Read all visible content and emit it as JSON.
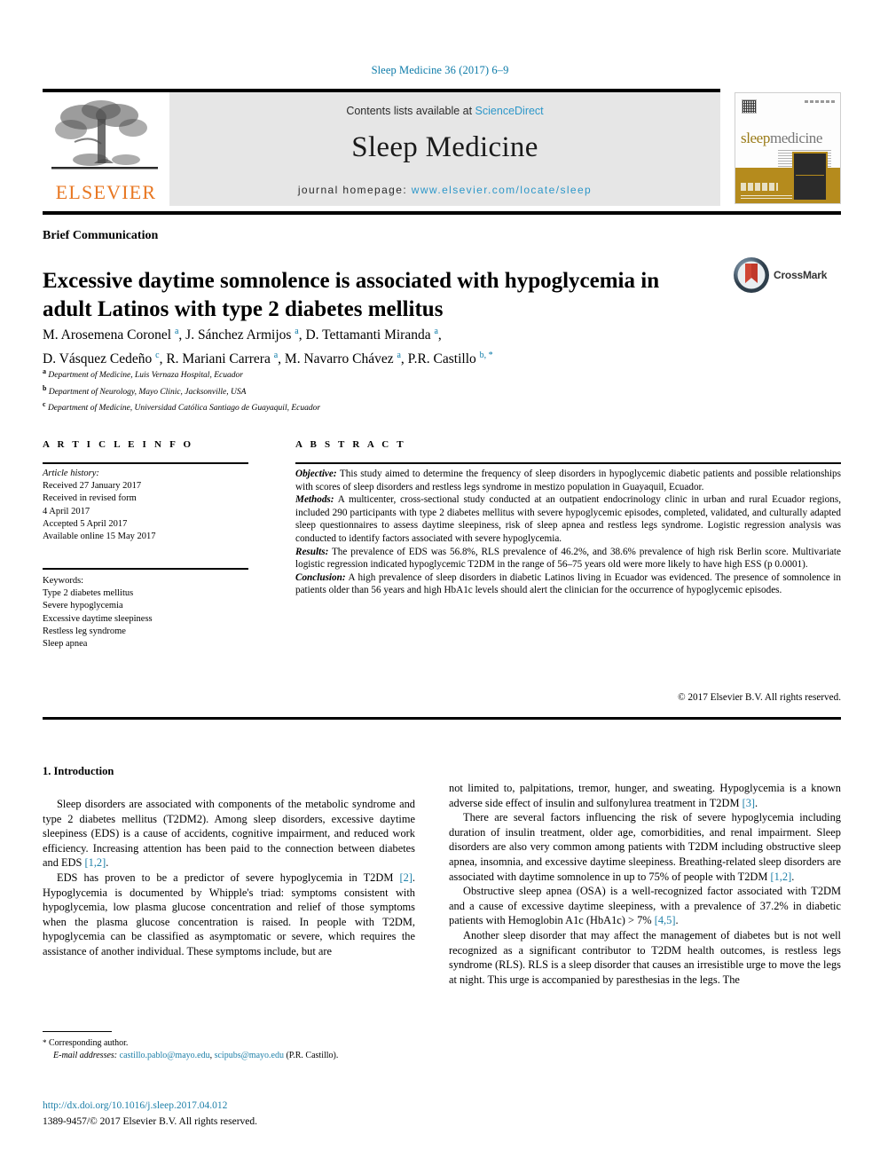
{
  "running_head": "Sleep Medicine 36 (2017) 6–9",
  "masthead": {
    "contents_prefix": "Contents lists available at ",
    "sciencedirect": "ScienceDirect",
    "journal_title": "Sleep Medicine",
    "homepage_label": "journal homepage: ",
    "homepage_url": "www.elsevier.com/locate/sleep",
    "publisher_logo_text": "ELSEVIER",
    "publisher_logo_icon": "elsevier-tree-icon"
  },
  "cover": {
    "title_part1": "sleep",
    "title_part2": "medicine",
    "band_color": "#b58b1d"
  },
  "crossmark": {
    "label": "CrossMark",
    "icon": "crossmark-icon"
  },
  "article": {
    "type": "Brief Communication",
    "title": "Excessive daytime somnolence is associated with hypoglycemia in adult Latinos with type 2 diabetes mellitus",
    "authors_line_1": "M. Arosemena Coronel",
    "authors_html": "M. Arosemena Coronel <sup>a</sup>, J. Sánchez Armijos <sup>a</sup>, D. Tettamanti Miranda <sup>a</sup>,<br>D. Vásquez Cedeño <sup>c</sup>, R. Mariani Carrera <sup>a</sup>, M. Navarro Chávez <sup>a</sup>, P.R. Castillo <sup>b, *</sup>",
    "affiliations": [
      {
        "mark": "a",
        "text": "Department of Medicine, Luis Vernaza Hospital, Ecuador"
      },
      {
        "mark": "b",
        "text": "Department of Neurology, Mayo Clinic, Jacksonville, USA"
      },
      {
        "mark": "c",
        "text": "Department of Medicine, Universidad Católica Santiago de Guayaquil, Ecuador"
      }
    ]
  },
  "article_info": {
    "heading": "A R T I C L E   I N F O",
    "history_label": "Article history:",
    "history": [
      "Received 27 January 2017",
      "Received in revised form",
      "4 April 2017",
      "Accepted 5 April 2017",
      "Available online 15 May 2017"
    ],
    "keywords_label": "Keywords:",
    "keywords": [
      "Type 2 diabetes mellitus",
      "Severe hypoglycemia",
      "Excessive daytime sleepiness",
      "Restless leg syndrome",
      "Sleep apnea"
    ]
  },
  "abstract": {
    "heading": "A B S T R A C T",
    "sections": [
      {
        "label": "Objective:",
        "text": " This study aimed to determine the frequency of sleep disorders in hypoglycemic diabetic patients and possible relationships with scores of sleep disorders and restless legs syndrome in mestizo population in Guayaquil, Ecuador."
      },
      {
        "label": "Methods:",
        "text": " A multicenter, cross-sectional study conducted at an outpatient endocrinology clinic in urban and rural Ecuador regions, included 290 participants with type 2 diabetes mellitus with severe hypoglycemic episodes, completed, validated, and culturally adapted sleep questionnaires to assess daytime sleepiness, risk of sleep apnea and restless legs syndrome. Logistic regression analysis was conducted to identify factors associated with severe hypoglycemia."
      },
      {
        "label": "Results:",
        "text": " The prevalence of EDS was 56.8%, RLS prevalence of 46.2%, and 38.6% prevalence of high risk Berlin score. Multivariate logistic regression indicated hypoglycemic T2DM in the range of 56–75 years old were more likely to have high ESS (p 0.0001)."
      },
      {
        "label": "Conclusion:",
        "text": " A high prevalence of sleep disorders in diabetic Latinos living in Ecuador was evidenced. The presence of somnolence in patients older than 56 years and high HbA1c levels should alert the clinician for the occurrence of hypoglycemic episodes."
      }
    ],
    "copyright": "© 2017 Elsevier B.V. All rights reserved."
  },
  "body": {
    "section_heading": "1. Introduction",
    "left_paragraphs_html": [
      "Sleep disorders are associated with components of the metabolic syndrome and type 2 diabetes mellitus (T2DM2). Among sleep disorders, excessive daytime sleepiness (EDS) is a cause of accidents, cognitive impairment, and reduced work efficiency. Increasing attention has been paid to the connection between diabetes and EDS <span class=\"ref\">[1,2]</span>.",
      "EDS has proven to be a predictor of severe hypoglycemia in T2DM <span class=\"ref\">[2]</span>. Hypoglycemia is documented by Whipple's triad: symptoms consistent with hypoglycemia, low plasma glucose concentration and relief of those symptoms when the plasma glucose concentration is raised. In people with T2DM, hypoglycemia can be classified as asymptomatic or severe, which requires the assistance of another individual. These symptoms include, but are"
    ],
    "right_paragraphs_html": [
      "not limited to, palpitations, tremor, hunger, and sweating. Hypoglycemia is a known adverse side effect of insulin and sulfonylurea treatment in T2DM <span class=\"ref\">[3]</span>.",
      "There are several factors influencing the risk of severe hypoglycemia including duration of insulin treatment, older age, comorbidities, and renal impairment. Sleep disorders are also very common among patients with T2DM including obstructive sleep apnea, insomnia, and excessive daytime sleepiness. Breathing-related sleep disorders are associated with daytime somnolence in up to 75% of people with T2DM <span class=\"ref\">[1,2]</span>.",
      "Obstructive sleep apnea (OSA) is a well-recognized factor associated with T2DM and a cause of excessive daytime sleepiness, with a prevalence of 37.2% in diabetic patients with Hemoglobin A1c (HbA1c) &gt; 7% <span class=\"ref\">[4,5]</span>.",
      "Another sleep disorder that may affect the management of diabetes but is not well recognized as a significant contributor to T2DM health outcomes, is restless legs syndrome (RLS). RLS is a sleep disorder that causes an irresistible urge to move the legs at night. This urge is accompanied by paresthesias in the legs. The"
    ]
  },
  "footer": {
    "corresponding_marker": "*",
    "corresponding_label": "Corresponding author.",
    "email_label": "E-mail addresses:",
    "email_1": "castillo.pablo@mayo.edu",
    "email_sep": ", ",
    "email_2": "scipubs@mayo.edu",
    "email_suffix": " (P.R. Castillo).",
    "doi": "http://dx.doi.org/10.1016/j.sleep.2017.04.012",
    "issn_line": "1389-9457/© 2017 Elsevier B.V. All rights reserved."
  }
}
